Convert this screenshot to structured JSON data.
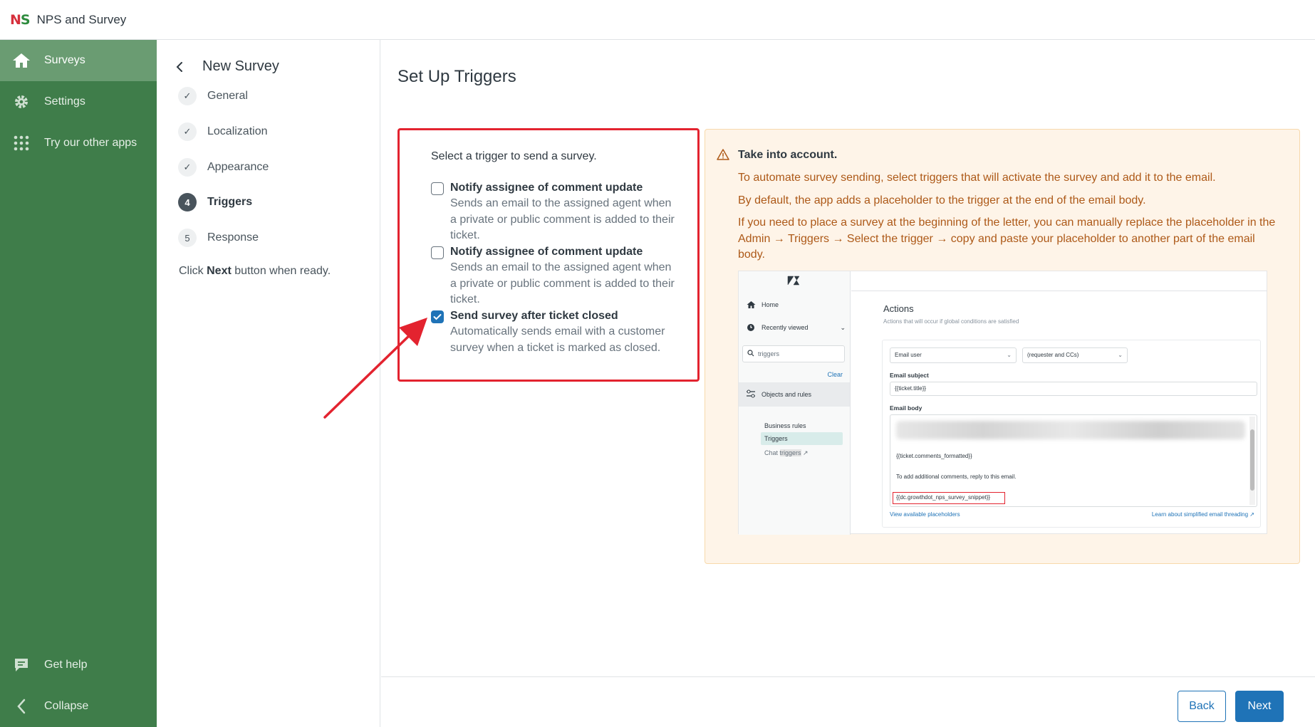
{
  "app": {
    "logo_n": "N",
    "logo_s": "S",
    "title": "NPS and Survey"
  },
  "sidebar": {
    "items": [
      {
        "label": "Surveys",
        "icon": "home-icon"
      },
      {
        "label": "Settings",
        "icon": "gear-icon"
      },
      {
        "label": "Try our other apps",
        "icon": "grid-icon"
      }
    ],
    "bottom": [
      {
        "label": "Get help",
        "icon": "chat-icon"
      },
      {
        "label": "Collapse",
        "icon": "chevron-left-icon"
      }
    ]
  },
  "steps": {
    "title": "New Survey",
    "items": [
      {
        "label": "General",
        "marker": "✓"
      },
      {
        "label": "Localization",
        "marker": "✓"
      },
      {
        "label": "Appearance",
        "marker": "✓"
      },
      {
        "label": "Triggers",
        "marker": "4"
      },
      {
        "label": "Response",
        "marker": "5"
      }
    ],
    "hint_pre": "Click ",
    "hint_bold": "Next",
    "hint_post": " button when ready."
  },
  "main": {
    "title": "Set Up Triggers",
    "trigger_heading": "Select a trigger to send a survey.",
    "options": [
      {
        "title": "Notify assignee of comment update",
        "desc": "Sends an email to the assigned agent when a private or public comment is added to their ticket.",
        "checked": false
      },
      {
        "title": "Notify assignee of comment update",
        "desc": "Sends an email to the assigned agent when a private or public comment is added to their ticket.",
        "checked": false
      },
      {
        "title": "Send survey after ticket closed",
        "desc": "Automatically sends email with a customer survey when a ticket is marked as closed.",
        "checked": true
      }
    ],
    "info": {
      "heading": "Take into account.",
      "p1": "To automate survey sending, select triggers that will activate the survey and add it to the email.",
      "p2": "By default, the app adds a placeholder to the trigger at the end of the email body.",
      "p3": "If you need to place a survey at the beginning of the letter, you can manually replace the placeholder in the Admin → Triggers → Select the trigger → copy and paste your placeholder to another part of the email body."
    },
    "screenshot": {
      "home": "Home",
      "recent": "Recently viewed",
      "search_value": "triggers",
      "clear": "Clear",
      "objects": "Objects and rules",
      "business_rules": "Business rules",
      "triggers": "Triggers",
      "chat_pre": "Chat ",
      "chat_mark": "triggers",
      "actions_title": "Actions",
      "actions_sub": "Actions that will occur if global conditions are satisfied",
      "sel1": "Email user",
      "sel2": "(requester and CCs)",
      "subject_label": "Email subject",
      "subject_value": "{{ticket.title}}",
      "body_label": "Email body",
      "body_line1": "{{ticket.comments_formatted}}",
      "body_line2": "To add additional comments, reply to this email.",
      "snippet": "{{dc.growthdot_nps_survey_snippet}}",
      "link_left": "View available placeholders",
      "link_right": "Learn about simplified email threading"
    }
  },
  "footer": {
    "back": "Back",
    "next": "Next"
  },
  "colors": {
    "sidebar": "#3f7d4a",
    "active": "#6a9c72",
    "primary": "#1f73b7",
    "highlight": "#e3232f",
    "warn_bg": "#fef4e8",
    "warn_text": "#ad5918"
  }
}
